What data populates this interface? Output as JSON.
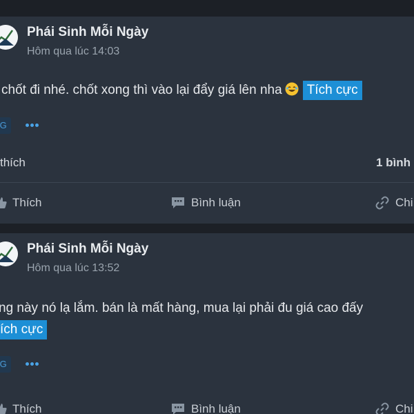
{
  "posts": [
    {
      "author": "Phái Sinh Mỗi Ngày",
      "time": "Hôm qua lúc 14:03",
      "content": "chốt đi nhé. chốt xong thì vào lại đẩy giá lên nha",
      "sentiment": "Tích cực",
      "badge": "IG",
      "likes_text": "thích",
      "comments_text": "1 bình"
    },
    {
      "author": "Phái Sinh Mỗi Ngày",
      "time": "Hôm qua lúc 13:52",
      "content": "ng này nó lạ lắm. bán là mất hàng, mua lại phải đu giá cao đấy",
      "sentiment": "ích cực",
      "badge": "IG"
    }
  ],
  "actions": {
    "like": "Thích",
    "comment": "Bình luận",
    "share": "Chi"
  },
  "colors": {
    "background": "#1c2026",
    "card": "#2b333e",
    "accent": "#1d8fd6"
  }
}
